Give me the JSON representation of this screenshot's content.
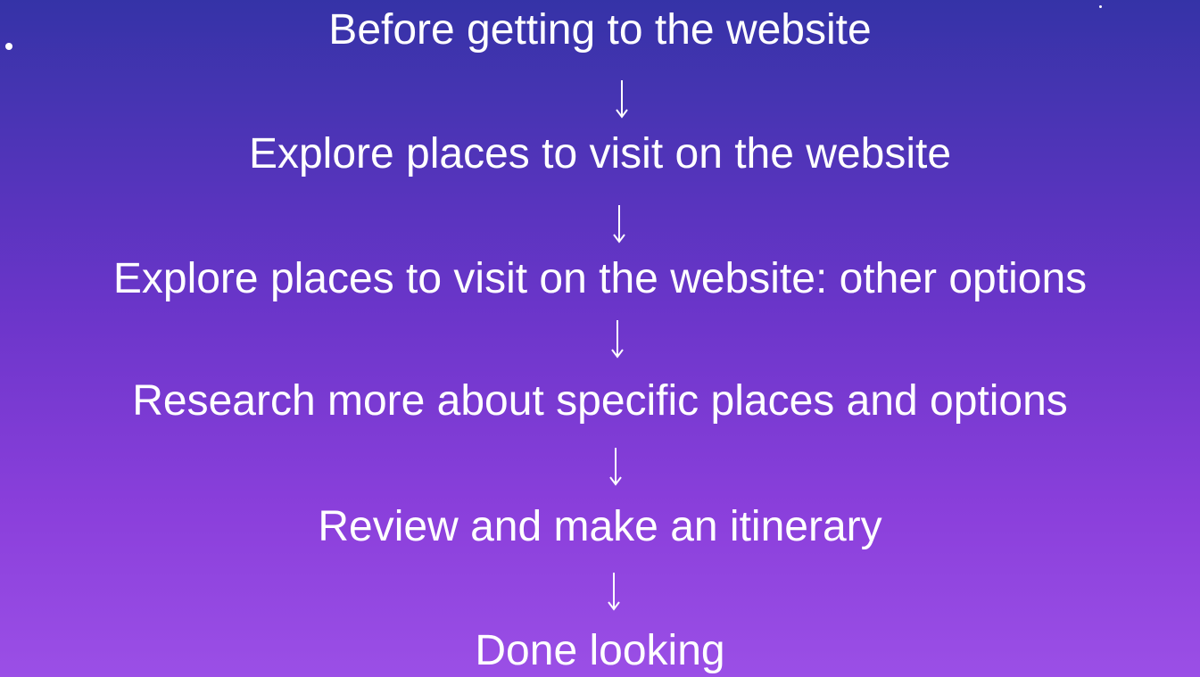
{
  "flow": {
    "steps": [
      "Before getting to the website",
      "Explore places to visit on the website",
      "Explore places to visit on the website: other options",
      "Research more about specific places and options",
      "Review and make an itinerary",
      "Done looking"
    ]
  },
  "colors": {
    "background_top": "#3533a7",
    "background_bottom": "#9b4fe6",
    "text": "#ffffff"
  }
}
